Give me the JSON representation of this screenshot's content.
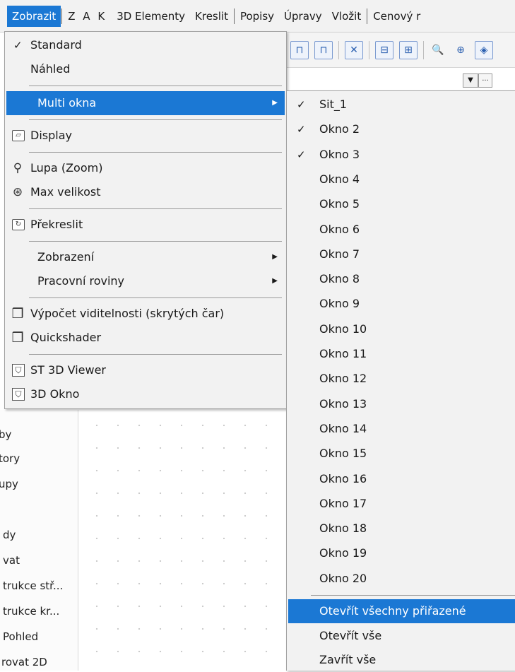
{
  "menubar": {
    "items": [
      "Zobrazit",
      "Z A K",
      "3D Elementy",
      "Kreslit",
      "Popisy",
      "Úpravy",
      "Vložit",
      "Cenový r"
    ]
  },
  "toolbar": {
    "icons": [
      "snap-icon",
      "snap-icon",
      "intersection-icon",
      "level-icon",
      "section-icon",
      "zoom-icon",
      "max-zoom-icon",
      "shield-icon"
    ]
  },
  "dropdown": {
    "arrow": "▼",
    "more": "..."
  },
  "left_panel": {
    "items": [
      "by",
      "tory",
      "upy",
      "dy",
      "vat",
      "trukce stř...",
      "trukce kr...",
      "Pohled",
      "rovat 2D"
    ]
  },
  "menu": {
    "standard": "Standard",
    "nahled": "Náhled",
    "multi_okna": "Multi okna",
    "display": "Display",
    "lupa": "Lupa (Zoom)",
    "max_velikost": "Max velikost",
    "prekreslit": "Překreslit",
    "zobrazeni": "Zobrazení",
    "pracovni_roviny": "Pracovní roviny",
    "vypocet": "Výpočet viditelnosti (skrytých čar)",
    "quickshader": "Quickshader",
    "st3d": "ST 3D Viewer",
    "okno3d": "3D Okno",
    "check_glyph": "✓",
    "arrow_glyph": "▶"
  },
  "submenu": {
    "items": [
      "Sit_1",
      "Okno 2",
      "Okno 3",
      "Okno 4",
      "Okno 5",
      "Okno 6",
      "Okno 7",
      "Okno 8",
      "Okno 9",
      "Okno 10",
      "Okno 11",
      "Okno 12",
      "Okno 13",
      "Okno 14",
      "Okno 15",
      "Okno 16",
      "Okno 17",
      "Okno 18",
      "Okno 19",
      "Okno 20"
    ],
    "checked": [
      true,
      true,
      true,
      false,
      false,
      false,
      false,
      false,
      false,
      false,
      false,
      false,
      false,
      false,
      false,
      false,
      false,
      false,
      false,
      false
    ],
    "otevrit_vsechny": "Otevřít všechny přiřazené",
    "otevrit_vse": "Otevřít vše",
    "zavrit_vse": "Zavřít vše"
  },
  "colors": {
    "highlight": "#1b78d4",
    "menu_bg": "#f2f2f2"
  }
}
